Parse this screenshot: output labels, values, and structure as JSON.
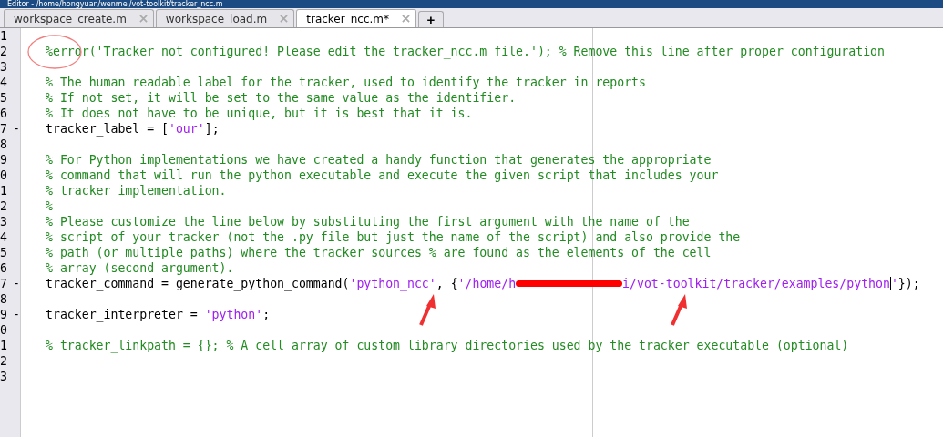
{
  "window": {
    "title": "Editor - /home/hongyuan/wenmei/vot-toolkit/tracker_ncc.m"
  },
  "tabs": [
    {
      "label": "workspace_create.m",
      "selected": false
    },
    {
      "label": "workspace_load.m",
      "selected": false
    },
    {
      "label": "tracker_ncc.m*",
      "selected": true
    }
  ],
  "new_tab_button": "+",
  "lines": [
    {
      "number": "1"
    },
    {
      "number": "2",
      "tokens": [
        {
          "kind": "comment",
          "text": "%error(",
          "circled": true
        },
        {
          "kind": "comment",
          "text": "'Tracker not configured! Please edit the tracker_ncc.m file.'); % Remove this line after proper configuration"
        }
      ]
    },
    {
      "number": "3"
    },
    {
      "number": "4",
      "tokens": [
        {
          "kind": "comment",
          "text": "% The human readable label for the tracker, used to identify the tracker in reports"
        }
      ]
    },
    {
      "number": "5",
      "tokens": [
        {
          "kind": "comment",
          "text": "% If not set, it will be set to the same value as the identifier."
        }
      ]
    },
    {
      "number": "6",
      "tokens": [
        {
          "kind": "comment",
          "text": "% It does not have to be unique, but it is best that it is."
        }
      ]
    },
    {
      "number": "7",
      "marker": "-",
      "tokens": [
        {
          "kind": "code",
          "text": "tracker_label = ["
        },
        {
          "kind": "string",
          "text": "'our'"
        },
        {
          "kind": "code",
          "text": "];"
        }
      ]
    },
    {
      "number": "8"
    },
    {
      "number": "9",
      "tokens": [
        {
          "kind": "comment",
          "text": "% For Python implementations we have created a handy function that generates the appropriate"
        }
      ]
    },
    {
      "number": "0",
      "tokens": [
        {
          "kind": "comment",
          "text": "% command that will run the python executable and execute the given script that includes your"
        }
      ]
    },
    {
      "number": "1",
      "tokens": [
        {
          "kind": "comment",
          "text": "% tracker implementation."
        }
      ]
    },
    {
      "number": "2",
      "tokens": [
        {
          "kind": "comment",
          "text": "%"
        }
      ]
    },
    {
      "number": "3",
      "tokens": [
        {
          "kind": "comment",
          "text": "% Please customize the line below by substituting the first argument with the name of the"
        }
      ]
    },
    {
      "number": "4",
      "tokens": [
        {
          "kind": "comment",
          "text": "% script of your tracker (not the .py file but just the name of the script) and also provide the"
        }
      ]
    },
    {
      "number": "5",
      "tokens": [
        {
          "kind": "comment",
          "text": "% path (or multiple paths) where the tracker sources % are found as the elements of the cell"
        }
      ]
    },
    {
      "number": "6",
      "tokens": [
        {
          "kind": "comment",
          "text": "% array (second argument)."
        }
      ]
    },
    {
      "number": "7",
      "marker": "-",
      "tokens": [
        {
          "kind": "code",
          "text": "tracker_command = generate_python_command("
        },
        {
          "kind": "string",
          "text": "'python_ncc'",
          "pointed_at": true
        },
        {
          "kind": "code",
          "text": ", {"
        },
        {
          "kind": "string",
          "text": "'/home/h"
        },
        {
          "kind": "redacted"
        },
        {
          "kind": "string",
          "text": "i/vot-too",
          "pointed_at": true
        },
        {
          "kind": "string",
          "text": "lkit/tracker/examples/python"
        },
        {
          "kind": "cursor"
        },
        {
          "kind": "string",
          "text": "'"
        },
        {
          "kind": "code",
          "text": "});"
        }
      ]
    },
    {
      "number": "8"
    },
    {
      "number": "9",
      "marker": "-",
      "tokens": [
        {
          "kind": "code",
          "text": "tracker_interpreter = "
        },
        {
          "kind": "string",
          "text": "'python'"
        },
        {
          "kind": "code",
          "text": ";"
        }
      ]
    },
    {
      "number": "0"
    },
    {
      "number": "1",
      "tokens": [
        {
          "kind": "comment",
          "text": "% tracker_linkpath = {}; % A cell array of custom library directories used by the tracker executable (optional)"
        }
      ]
    },
    {
      "number": "2"
    },
    {
      "number": "3"
    }
  ]
}
